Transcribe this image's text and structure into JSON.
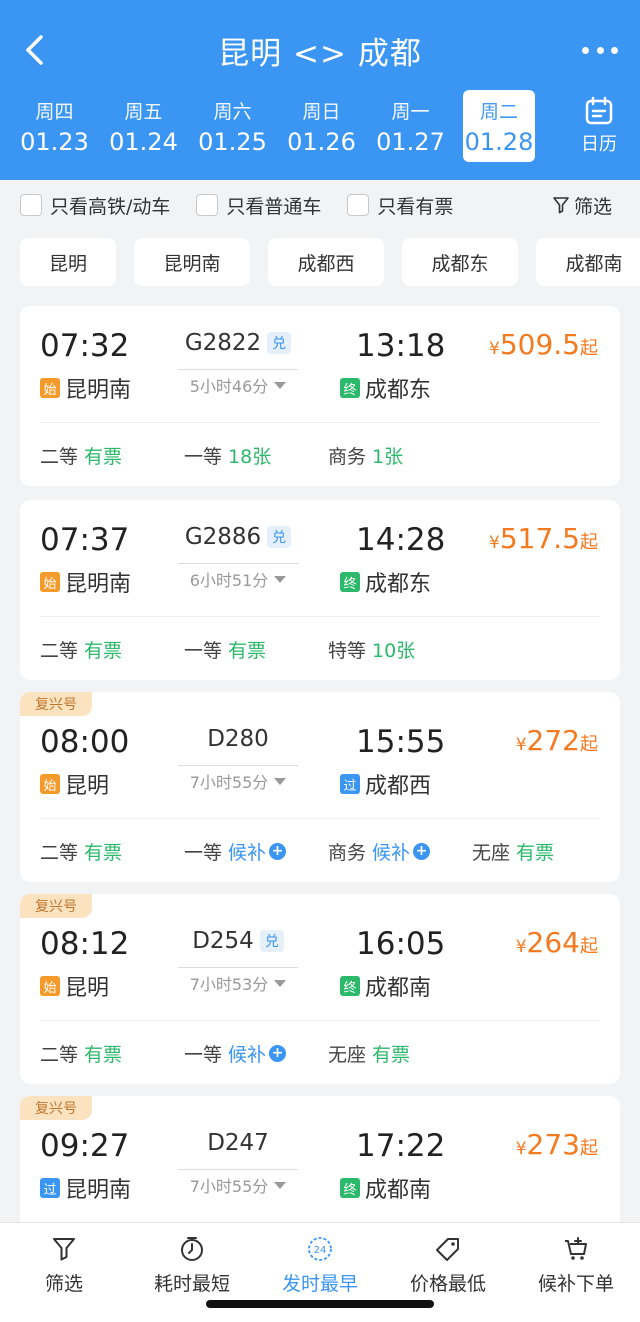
{
  "header": {
    "title": "昆明 <> 成都",
    "dates": [
      {
        "weekday": "周四",
        "date": "01.23"
      },
      {
        "weekday": "周五",
        "date": "01.24"
      },
      {
        "weekday": "周六",
        "date": "01.25"
      },
      {
        "weekday": "周日",
        "date": "01.26"
      },
      {
        "weekday": "周一",
        "date": "01.27"
      },
      {
        "weekday": "周二",
        "date": "01.28",
        "active": true
      }
    ],
    "calendar_label": "日历",
    "accent_color": "#3b95f3"
  },
  "filters": {
    "high_speed": "只看高铁/动车",
    "regular": "只看普通车",
    "available": "只看有票",
    "filter_btn": "筛选"
  },
  "stations": [
    "昆明",
    "昆明南",
    "成都西",
    "成都东",
    "成都南"
  ],
  "trains": [
    {
      "fuxing": "",
      "dep_time": "07:32",
      "dep_tag": "始",
      "dep_station": "昆明南",
      "train_no": "G2822",
      "duiyue": "兑",
      "duration": "5小时46分",
      "arr_time": "13:18",
      "arr_tag": "终",
      "arr_station": "成都东",
      "price_cur": "¥",
      "price": "509.5",
      "price_suffix": "起",
      "seats": [
        {
          "name": "二等",
          "value": "有票",
          "color": "green"
        },
        {
          "name": "一等",
          "value": "18张",
          "color": "green"
        },
        {
          "name": "商务",
          "value": "1张",
          "color": "green"
        }
      ]
    },
    {
      "fuxing": "",
      "dep_time": "07:37",
      "dep_tag": "始",
      "dep_station": "昆明南",
      "train_no": "G2886",
      "duiyue": "兑",
      "duration": "6小时51分",
      "arr_time": "14:28",
      "arr_tag": "终",
      "arr_station": "成都东",
      "price_cur": "¥",
      "price": "517.5",
      "price_suffix": "起",
      "seats": [
        {
          "name": "二等",
          "value": "有票",
          "color": "green"
        },
        {
          "name": "一等",
          "value": "有票",
          "color": "green"
        },
        {
          "name": "特等",
          "value": "10张",
          "color": "green"
        }
      ]
    },
    {
      "fuxing": "复兴号",
      "dep_time": "08:00",
      "dep_tag": "始",
      "dep_station": "昆明",
      "train_no": "D280",
      "duiyue": "",
      "duration": "7小时55分",
      "arr_time": "15:55",
      "arr_tag": "过",
      "arr_station": "成都西",
      "price_cur": "¥",
      "price": "272",
      "price_suffix": "起",
      "seats": [
        {
          "name": "二等",
          "value": "有票",
          "color": "green"
        },
        {
          "name": "一等",
          "value": "候补",
          "color": "blue",
          "plus": true
        },
        {
          "name": "商务",
          "value": "候补",
          "color": "blue",
          "plus": true
        },
        {
          "name": "无座",
          "value": "有票",
          "color": "green"
        }
      ]
    },
    {
      "fuxing": "复兴号",
      "dep_time": "08:12",
      "dep_tag": "始",
      "dep_station": "昆明",
      "train_no": "D254",
      "duiyue": "兑",
      "duration": "7小时53分",
      "arr_time": "16:05",
      "arr_tag": "终",
      "arr_station": "成都南",
      "price_cur": "¥",
      "price": "264",
      "price_suffix": "起",
      "seats": [
        {
          "name": "二等",
          "value": "有票",
          "color": "green"
        },
        {
          "name": "一等",
          "value": "候补",
          "color": "blue",
          "plus": true
        },
        {
          "name": "无座",
          "value": "有票",
          "color": "green"
        }
      ]
    },
    {
      "fuxing": "复兴号",
      "dep_time": "09:27",
      "dep_tag": "过",
      "dep_station": "昆明南",
      "train_no": "D247",
      "duiyue": "",
      "duration": "7小时55分",
      "arr_time": "17:22",
      "arr_tag": "终",
      "arr_station": "成都南",
      "price_cur": "¥",
      "price": "273",
      "price_suffix": "起",
      "seats": []
    }
  ],
  "bottom_tabs": [
    {
      "label": "筛选",
      "icon": "filter-icon"
    },
    {
      "label": "耗时最短",
      "icon": "timer-icon"
    },
    {
      "label": "发时最早",
      "icon": "clock-24-icon",
      "active": true
    },
    {
      "label": "价格最低",
      "icon": "price-tag-icon"
    },
    {
      "label": "候补下单",
      "icon": "cart-icon"
    }
  ],
  "icon_text": {
    "clock24": "24"
  }
}
